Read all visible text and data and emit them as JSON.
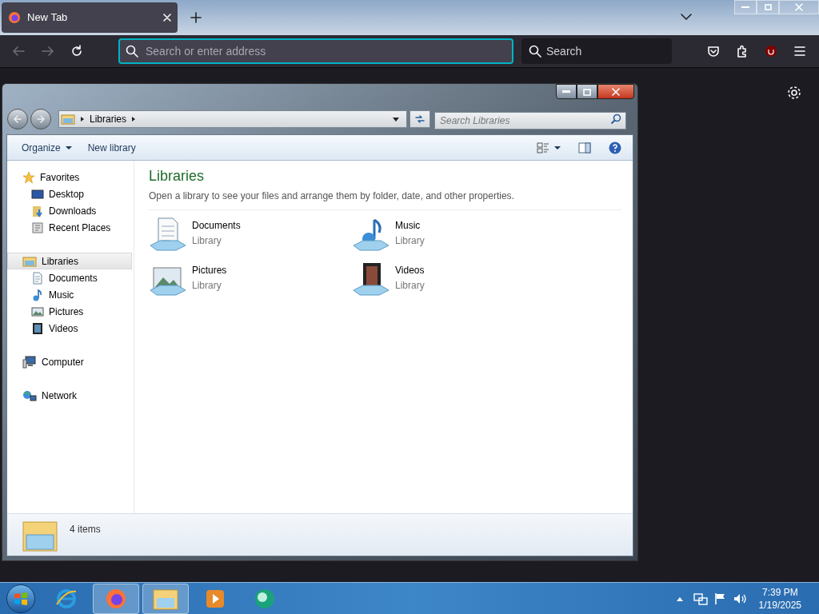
{
  "browser": {
    "tabs": [
      {
        "title": "New Tab",
        "selected": true
      }
    ],
    "address_placeholder": "Search or enter address",
    "search_placeholder": "Search"
  },
  "explorer": {
    "breadcrumb": [
      "Libraries"
    ],
    "search_placeholder": "Search Libraries",
    "commands": [
      {
        "label": "Organize",
        "kind": "menu"
      },
      {
        "label": "New library",
        "kind": "plain"
      }
    ],
    "nav": [
      {
        "label": "Favorites",
        "selected": false,
        "children": [
          {
            "label": "Desktop"
          },
          {
            "label": "Downloads"
          },
          {
            "label": "Recent Places"
          }
        ]
      },
      {
        "label": "Libraries",
        "selected": true,
        "children": [
          {
            "label": "Documents"
          },
          {
            "label": "Music"
          },
          {
            "label": "Pictures"
          },
          {
            "label": "Videos"
          }
        ]
      },
      {
        "label": "Computer",
        "selected": false
      },
      {
        "label": "Network",
        "selected": false
      }
    ],
    "heading": "Libraries",
    "description": "Open a library to see your files and arrange them by folder, date, and other properties.",
    "items": [
      {
        "name": "Documents",
        "type": "Library"
      },
      {
        "name": "Music",
        "type": "Library"
      },
      {
        "name": "Pictures",
        "type": "Library"
      },
      {
        "name": "Videos",
        "type": "Library"
      }
    ],
    "status": "4 items"
  },
  "taskbar": {
    "apps": [
      {
        "kind": "browser-e",
        "open": false
      },
      {
        "kind": "firefox",
        "open": true
      },
      {
        "kind": "folder",
        "open": true
      },
      {
        "kind": "media",
        "open": false
      },
      {
        "kind": "globe",
        "open": false
      }
    ],
    "time": "7:39 PM",
    "date": "1/19/2025"
  }
}
